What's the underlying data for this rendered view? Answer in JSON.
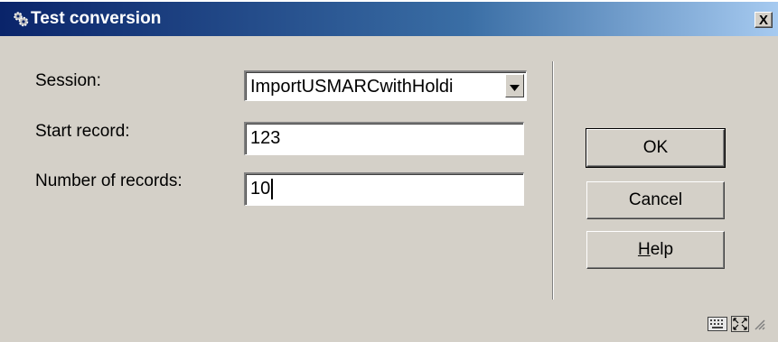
{
  "window": {
    "title": "Test conversion",
    "close_label": "X"
  },
  "form": {
    "session_label": "Session:",
    "session_value": "ImportUSMARCwithHoldi",
    "start_record_label": "Start record:",
    "start_record_value": "123",
    "number_of_records_label": "Number of records:",
    "number_of_records_value": "10"
  },
  "buttons": {
    "ok": "OK",
    "cancel": "Cancel",
    "help_underlined": "H",
    "help_rest": "elp"
  },
  "icons": {
    "title": "conversion-gears-icon",
    "keyboard": "keyboard-icon",
    "resize": "resize-icon"
  },
  "colors": {
    "titlebar_start": "#0a246a",
    "titlebar_end": "#a6caf0",
    "dialog_bg": "#d4d0c8"
  }
}
